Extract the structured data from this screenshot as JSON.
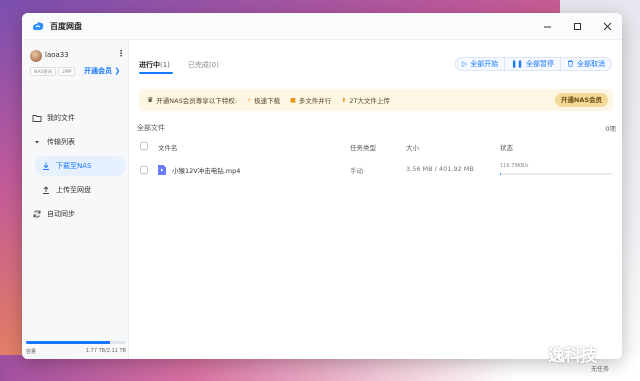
{
  "app": {
    "title": "百度网盘"
  },
  "user": {
    "name": "laoa33",
    "badge_1": "NAS会员",
    "badge_2": "2MP",
    "vip_link": "开通会员 ❯"
  },
  "sidebar": {
    "items": [
      {
        "label": "我的文件",
        "icon": "folder-icon"
      },
      {
        "label": "传输列表",
        "icon": "caret-down-icon"
      },
      {
        "label": "下载至NAS",
        "icon": "download-icon"
      },
      {
        "label": "上传至网盘",
        "icon": "upload-icon"
      },
      {
        "label": "自动同步",
        "icon": "sync-icon"
      }
    ],
    "storage": {
      "label": "容量",
      "value": "1.77 TB/2.11 TB",
      "used_fraction": 0.84
    }
  },
  "tabs": {
    "active": "进行中",
    "active_count": "(1)",
    "done": "已完成",
    "done_count": "(0)"
  },
  "actions": {
    "start_all": "全部开始",
    "pause_all": "全部暂停",
    "cancel_all": "全部取消"
  },
  "promo": {
    "text": "开通NAS会员尊享以下特权:",
    "features": [
      "极速下载",
      "多文件并行",
      "2T大文件上传"
    ],
    "button": "开通NAS会员"
  },
  "list": {
    "title": "全部文件",
    "count_label": "0项",
    "headers": {
      "name": "文件名",
      "type": "任务类型",
      "size": "大小",
      "status": "状态"
    },
    "rows": [
      {
        "name": "小猴12V冲击电钻.mp4",
        "type": "手动",
        "size": "3.56 MB / 401.92 MB",
        "speed": "116.79KB/s",
        "progress": 0.01
      }
    ]
  },
  "watermark": {
    "main": "逸科技",
    "sub": "无任务"
  },
  "colors": {
    "accent": "#1677ff",
    "promo_bg": "#fdf6e4",
    "promo_button": "#f5d99a"
  }
}
